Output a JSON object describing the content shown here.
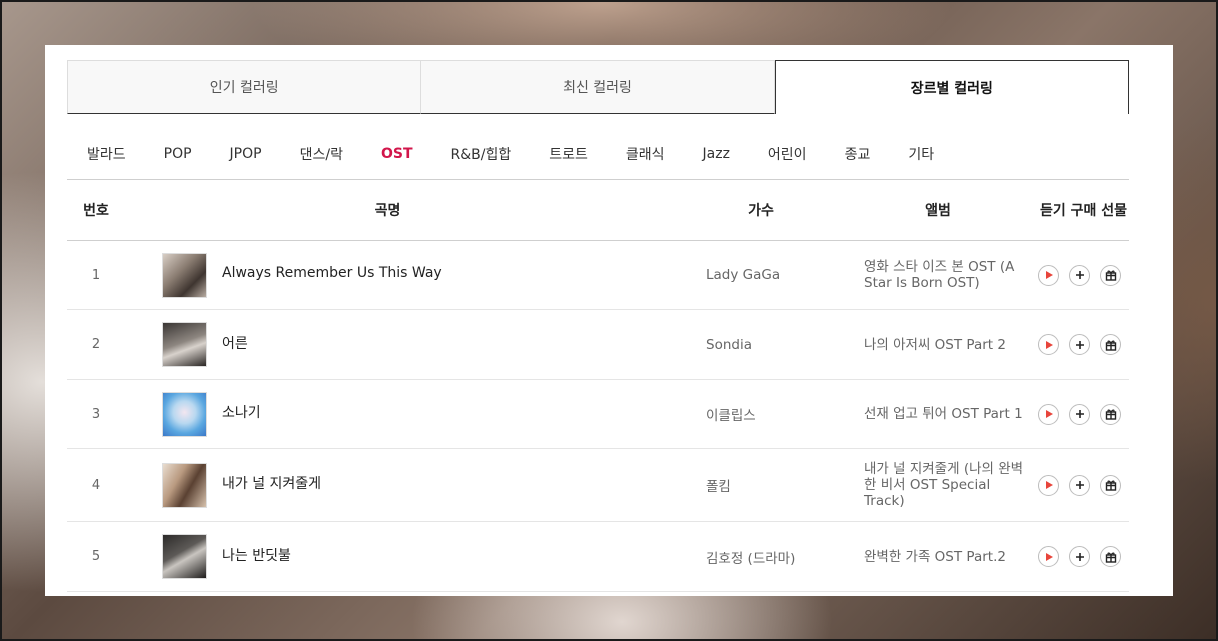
{
  "tabs": [
    {
      "label": "인기 컬러링",
      "active": false
    },
    {
      "label": "최신 컬러링",
      "active": false
    },
    {
      "label": "장르별 컬러링",
      "active": true
    }
  ],
  "genres": [
    "발라드",
    "POP",
    "JPOP",
    "댄스/락",
    "OST",
    "R&B/힙합",
    "트로트",
    "클래식",
    "Jazz",
    "어린이",
    "종교",
    "기타"
  ],
  "active_genre": "OST",
  "table": {
    "headers": {
      "no": "번호",
      "song": "곡명",
      "artist": "가수",
      "album": "앨범",
      "actions": "듣기 구매 선물"
    },
    "rows": [
      {
        "no": "1",
        "title": "Always Remember Us This Way",
        "artist": "Lady GaGa",
        "album": "영화 스타 이즈 본 OST (A Star Is Born OST)"
      },
      {
        "no": "2",
        "title": "어른",
        "artist": "Sondia",
        "album": "나의 아저씨 OST Part 2"
      },
      {
        "no": "3",
        "title": "소나기",
        "artist": "이클립스",
        "album": "선재 업고 튀어 OST Part 1"
      },
      {
        "no": "4",
        "title": "내가 널 지켜줄게",
        "artist": "폴킴",
        "album": "내가 널 지켜줄게 (나의 완벽한 비서 OST Special Track)"
      },
      {
        "no": "5",
        "title": "나는 반딧불",
        "artist": "김호정 (드라마)",
        "album": "완벽한 가족 OST Part.2"
      }
    ]
  },
  "colors": {
    "accent": "#d2164b",
    "play_icon": "#e8453c"
  },
  "icons": {
    "play": "play-icon",
    "add": "plus-icon",
    "gift": "gift-icon"
  }
}
